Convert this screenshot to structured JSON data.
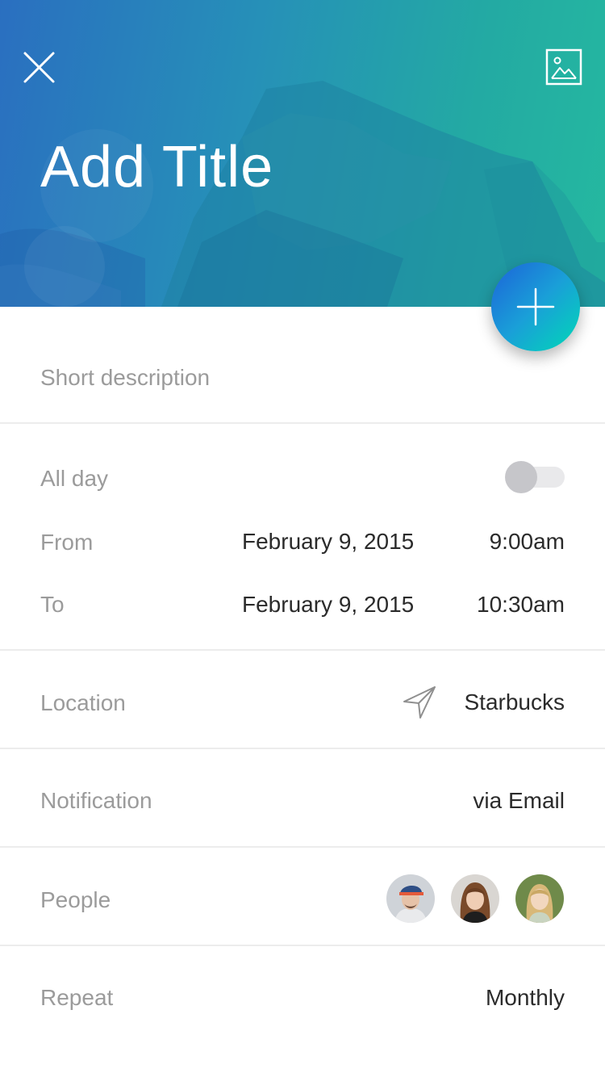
{
  "header": {
    "title": "Add Title",
    "close_icon": "close-icon",
    "image_icon": "image-icon"
  },
  "fab": {
    "icon": "plus-icon"
  },
  "description": {
    "placeholder": "Short description"
  },
  "all_day": {
    "label": "All day",
    "enabled": false
  },
  "from": {
    "label": "From",
    "date": "February 9, 2015",
    "time": "9:00am"
  },
  "to": {
    "label": "To",
    "date": "February 9, 2015",
    "time": "10:30am"
  },
  "location": {
    "label": "Location",
    "icon": "navigation-arrow-icon",
    "value": "Starbucks"
  },
  "notification": {
    "label": "Notification",
    "value": "via Email"
  },
  "people": {
    "label": "People",
    "avatars": [
      "avatar-man-cap",
      "avatar-woman-brown-hair",
      "avatar-woman-blonde"
    ]
  },
  "repeat": {
    "label": "Repeat",
    "value": "Monthly"
  },
  "colors": {
    "header_gradient_start": "#2a6fc0",
    "header_gradient_end": "#25b9a0",
    "fab_gradient_start": "#1c63d9",
    "fab_gradient_end": "#00d9b6",
    "label_gray": "#9b9b9b",
    "value_dark": "#2b2b2b",
    "divider": "#ececec"
  }
}
